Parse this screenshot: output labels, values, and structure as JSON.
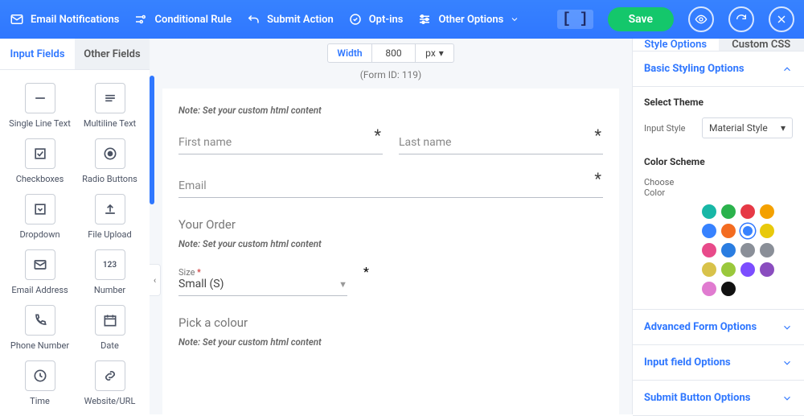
{
  "topbar": {
    "email_notifications": "Email Notifications",
    "conditional_rule": "Conditional Rule",
    "submit_action": "Submit Action",
    "opt_ins": "Opt-ins",
    "other_options": "Other Options",
    "save": "Save"
  },
  "left": {
    "tabs": {
      "input_fields": "Input Fields",
      "other_fields": "Other Fields"
    },
    "fields": [
      {
        "label": "Single Line Text"
      },
      {
        "label": "Multiline Text"
      },
      {
        "label": "Checkboxes"
      },
      {
        "label": "Radio Buttons"
      },
      {
        "label": "Dropdown"
      },
      {
        "label": "File Upload"
      },
      {
        "label": "Email Address"
      },
      {
        "label": "Number"
      },
      {
        "label": "Phone Number"
      },
      {
        "label": "Date"
      },
      {
        "label": "Time"
      },
      {
        "label": "Website/URL"
      }
    ]
  },
  "center": {
    "width_label": "Width",
    "width_value": "800",
    "width_unit": "px",
    "form_id": "(Form ID: 119)",
    "note": "Note: Set your custom html content",
    "first_name": "First name",
    "last_name": "Last name",
    "email": "Email",
    "your_order": "Your Order",
    "size_label": "Size",
    "size_value": "Small (S)",
    "pick_colour": "Pick a colour"
  },
  "right": {
    "tabs": {
      "style_options": "Style Options",
      "custom_css": "Custom CSS"
    },
    "basic_styling": "Basic Styling Options",
    "select_theme": "Select Theme",
    "input_style_label": "Input Style",
    "input_style_value": "Material Style",
    "color_scheme": "Color Scheme",
    "choose_color": "Choose Color",
    "swatches": [
      "#18b7a6",
      "#2bb24c",
      "#e63946",
      "#f4a100",
      "#3782ff",
      "#f36c21",
      "#3782ff",
      "#e8c90c",
      "#e84a8a",
      "#2a7de1",
      "#8a8f98",
      "#8a8f98",
      "#d8c24a",
      "#9ac83c",
      "#7c4dff",
      "#8a4dbf",
      "#e07bd0",
      "#111111"
    ],
    "selected_swatch_index": 6,
    "advanced_form": "Advanced Form Options",
    "input_field_opts": "Input field Options",
    "submit_button_opts": "Submit Button Options"
  }
}
